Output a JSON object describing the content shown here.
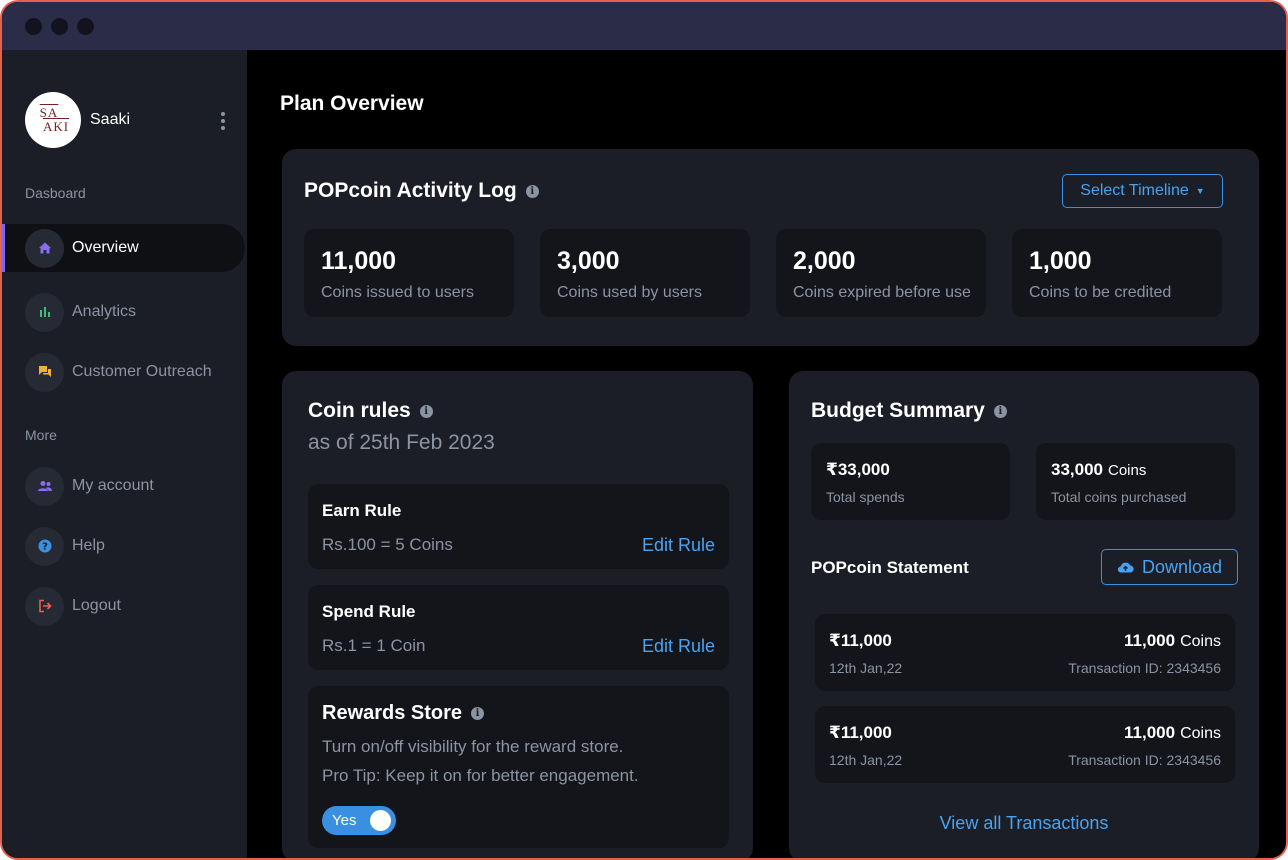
{
  "window": {
    "controls": [
      "close",
      "minimize",
      "maximize"
    ]
  },
  "sidebar": {
    "brand": {
      "logo_line1": "SA",
      "logo_line2": "AKI",
      "name": "Saaki"
    },
    "sections": {
      "dashboard": "Dasboard",
      "more": "More"
    },
    "items": [
      {
        "label": "Overview",
        "icon": "home-icon",
        "active": true
      },
      {
        "label": "Analytics",
        "icon": "bar-chart-icon",
        "active": false
      },
      {
        "label": "Customer Outreach",
        "icon": "chat-icon",
        "active": false
      },
      {
        "label": "My account",
        "icon": "users-icon",
        "active": false
      },
      {
        "label": "Help",
        "icon": "help-icon",
        "active": false
      },
      {
        "label": "Logout",
        "icon": "logout-icon",
        "active": false
      }
    ]
  },
  "main": {
    "page_title": "Plan Overview",
    "activity_log": {
      "title": "POPcoin Activity Log",
      "timeline_button": "Select Timeline",
      "stats": [
        {
          "value": "11,000",
          "label": "Coins issued to users"
        },
        {
          "value": "3,000",
          "label": "Coins used by users"
        },
        {
          "value": "2,000",
          "label": "Coins expired before use"
        },
        {
          "value": "1,000",
          "label": "Coins to be credited"
        }
      ]
    },
    "coin_rules": {
      "title": "Coin rules",
      "subtitle": "as of 25th Feb 2023",
      "earn": {
        "title": "Earn Rule",
        "text": "Rs.100 = 5 Coins",
        "link": "Edit Rule"
      },
      "spend": {
        "title": "Spend Rule",
        "text": "Rs.1 = 1 Coin",
        "link": "Edit Rule"
      },
      "rewards": {
        "title": "Rewards Store",
        "line1": "Turn on/off visibility for the reward store.",
        "line2": "Pro Tip: Keep it on for better engagement.",
        "toggle_label": "Yes"
      }
    },
    "budget": {
      "title": "Budget Summary",
      "spends": {
        "value": "₹33,000",
        "label": "Total spends"
      },
      "coins": {
        "value": "33,000",
        "unit": "Coins",
        "label": "Total coins purchased"
      },
      "statement_title": "POPcoin Statement",
      "download_label": "Download",
      "transactions": [
        {
          "amount": "₹11,000",
          "date": "12th Jan,22",
          "coins": "11,000",
          "unit": "Coins",
          "txid": "Transaction ID: 2343456"
        },
        {
          "amount": "₹11,000",
          "date": "12th Jan,22",
          "coins": "11,000",
          "unit": "Coins",
          "txid": "Transaction ID: 2343456"
        }
      ],
      "view_all": "View all Transactions"
    }
  },
  "colors": {
    "accent": "#4aa3f0",
    "active_indicator": "#7b68ee",
    "window_border": "#e8604c"
  }
}
